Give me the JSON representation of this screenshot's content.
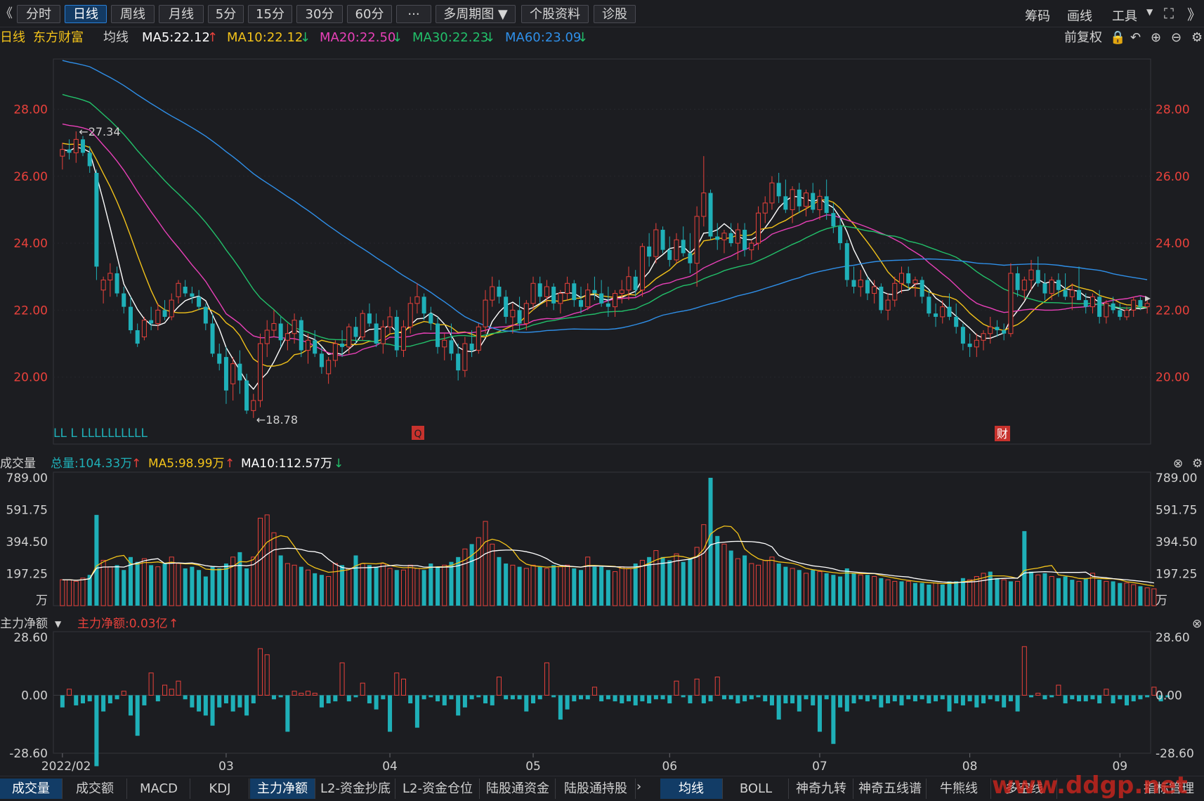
{
  "toolbar": {
    "collapse": "《",
    "tabs": [
      "分时",
      "日线",
      "周线",
      "月线",
      "5分",
      "15分",
      "30分",
      "60分",
      "···",
      "多周期图",
      "个股资料",
      "诊股"
    ],
    "active_tab": "日线",
    "right": [
      "筹码",
      "画线",
      "工具"
    ]
  },
  "infobar": {
    "period": "日线",
    "stock": "东方财富",
    "indicator": "均线",
    "ma5": "MA5:22.12",
    "ma10": "MA10:22.12",
    "ma20": "MA20:22.50",
    "ma30": "MA30:22.23",
    "ma60": "MA60:23.09",
    "adjust": "前复权"
  },
  "colors": {
    "up": "#e8413b",
    "down": "#1fb0b8",
    "ma5": "#ffffff",
    "ma10": "#f2c21a",
    "ma20": "#e840b8",
    "ma30": "#22c06a",
    "ma60": "#2f8fe8"
  },
  "price_panel": {
    "y_ticks": [
      "28.00",
      "26.00",
      "24.00",
      "22.00",
      "20.00"
    ],
    "high_label": "←27.34",
    "low_label": "←18.78",
    "event_markers": [
      "LL L LLLLLLLLLL",
      "Q",
      "财"
    ]
  },
  "volume_panel": {
    "title": "成交量",
    "total": "总量:104.33万",
    "ma5": "MA5:98.99万",
    "ma10": "MA10:112.57万",
    "y_ticks": [
      "789.00",
      "591.75",
      "394.50",
      "197.25"
    ],
    "unit": "万"
  },
  "flow_panel": {
    "title": "主力净额",
    "value": "主力净额:0.03亿",
    "y_ticks": [
      "28.60",
      "0.00",
      "-28.60"
    ]
  },
  "x_axis": [
    "2022/02",
    "03",
    "04",
    "05",
    "06",
    "07",
    "08",
    "09"
  ],
  "bottom_tabs_left": [
    "成交量",
    "成交额",
    "MACD",
    "KDJ",
    "主力净额",
    "L2-资金抄底",
    "L2-资金仓位",
    "陆股通资金",
    "陆股通持股"
  ],
  "bottom_tabs_right": [
    "均线",
    "BOLL",
    "神奇九转",
    "神奇五线谱",
    "牛熊线",
    "多空线",
    "指标管理"
  ],
  "watermark": "www.ddgp.net",
  "chart_data": {
    "type": "candlestick",
    "title": "东方财富 日线",
    "x_range": [
      "2022/02",
      "2022/09"
    ],
    "ylim": [
      18.0,
      29.5
    ],
    "annotations": {
      "high": 27.34,
      "low": 18.78
    },
    "ohlc": [
      [
        26.6,
        27.0,
        26.2,
        26.8
      ],
      [
        26.8,
        27.1,
        26.5,
        26.7
      ],
      [
        26.7,
        27.34,
        26.4,
        27.1
      ],
      [
        27.1,
        27.2,
        26.6,
        26.7
      ],
      [
        26.7,
        26.9,
        26.1,
        26.3
      ],
      [
        26.1,
        26.2,
        22.9,
        23.3
      ],
      [
        22.6,
        23.0,
        22.2,
        22.9
      ],
      [
        22.9,
        23.4,
        22.4,
        23.1
      ],
      [
        23.1,
        23.3,
        22.4,
        22.5
      ],
      [
        22.5,
        22.7,
        21.9,
        22.1
      ],
      [
        22.1,
        22.4,
        21.3,
        21.4
      ],
      [
        21.4,
        21.6,
        20.9,
        21.0
      ],
      [
        21.2,
        21.8,
        21.1,
        21.7
      ],
      [
        21.7,
        22.1,
        21.4,
        21.6
      ],
      [
        21.6,
        22.2,
        21.4,
        22.0
      ],
      [
        22.0,
        22.3,
        21.7,
        21.8
      ],
      [
        21.8,
        22.5,
        21.7,
        22.3
      ],
      [
        22.4,
        22.9,
        22.2,
        22.8
      ],
      [
        22.7,
        22.9,
        22.4,
        22.5
      ],
      [
        22.5,
        22.7,
        22.2,
        22.4
      ],
      [
        22.4,
        22.6,
        22.0,
        22.1
      ],
      [
        22.1,
        22.2,
        21.4,
        21.6
      ],
      [
        21.6,
        21.9,
        20.6,
        20.7
      ],
      [
        20.7,
        21.0,
        20.2,
        20.4
      ],
      [
        20.6,
        20.9,
        19.2,
        19.6
      ],
      [
        19.8,
        20.6,
        19.3,
        20.4
      ],
      [
        20.4,
        20.8,
        19.5,
        19.9
      ],
      [
        19.9,
        20.1,
        18.9,
        19.0
      ],
      [
        19.0,
        19.5,
        18.78,
        19.3
      ],
      [
        19.3,
        21.3,
        19.1,
        21.0
      ],
      [
        21.0,
        21.7,
        20.6,
        21.4
      ],
      [
        21.4,
        22.0,
        21.2,
        21.6
      ],
      [
        21.6,
        21.8,
        20.9,
        21.1
      ],
      [
        21.1,
        21.6,
        20.8,
        21.3
      ],
      [
        21.3,
        21.9,
        21.0,
        21.7
      ],
      [
        21.7,
        21.8,
        20.6,
        20.8
      ],
      [
        20.8,
        21.3,
        20.4,
        21.1
      ],
      [
        21.1,
        21.4,
        20.6,
        20.7
      ],
      [
        20.7,
        20.9,
        20.1,
        20.3
      ],
      [
        20.1,
        20.6,
        19.8,
        20.5
      ],
      [
        20.5,
        21.1,
        20.3,
        21.0
      ],
      [
        21.0,
        21.4,
        20.6,
        20.9
      ],
      [
        20.9,
        21.6,
        20.7,
        21.5
      ],
      [
        21.5,
        21.8,
        21.0,
        21.2
      ],
      [
        21.2,
        22.0,
        21.1,
        21.9
      ],
      [
        21.9,
        22.2,
        21.5,
        21.6
      ],
      [
        21.6,
        21.9,
        20.9,
        21.0
      ],
      [
        21.0,
        21.7,
        20.7,
        21.5
      ],
      [
        21.5,
        22.1,
        21.3,
        21.8
      ],
      [
        21.8,
        22.0,
        20.6,
        20.8
      ],
      [
        20.8,
        21.7,
        20.6,
        21.5
      ],
      [
        21.5,
        22.4,
        21.3,
        22.2
      ],
      [
        22.2,
        22.8,
        21.9,
        22.4
      ],
      [
        22.4,
        22.5,
        21.7,
        21.9
      ],
      [
        21.9,
        22.1,
        21.4,
        21.6
      ],
      [
        21.6,
        21.8,
        20.7,
        20.9
      ],
      [
        20.9,
        21.3,
        20.5,
        21.1
      ],
      [
        21.1,
        21.6,
        20.5,
        20.7
      ],
      [
        20.7,
        21.0,
        19.9,
        20.2
      ],
      [
        20.2,
        21.2,
        20.0,
        21.0
      ],
      [
        21.0,
        21.4,
        20.6,
        20.8
      ],
      [
        20.8,
        21.6,
        20.7,
        21.5
      ],
      [
        21.5,
        22.6,
        21.3,
        22.3
      ],
      [
        22.3,
        23.0,
        22.1,
        22.7
      ],
      [
        22.7,
        22.9,
        22.2,
        22.4
      ],
      [
        22.4,
        22.6,
        21.6,
        21.8
      ],
      [
        21.8,
        22.2,
        21.3,
        22.0
      ],
      [
        22.0,
        22.4,
        21.4,
        21.6
      ],
      [
        21.6,
        22.3,
        21.4,
        22.2
      ],
      [
        22.2,
        23.0,
        22.0,
        22.8
      ],
      [
        22.8,
        23.0,
        22.2,
        22.4
      ],
      [
        22.4,
        22.9,
        22.1,
        22.7
      ],
      [
        22.7,
        22.8,
        22.0,
        22.2
      ],
      [
        22.2,
        22.6,
        21.9,
        22.5
      ],
      [
        22.5,
        23.0,
        22.3,
        22.8
      ],
      [
        22.8,
        22.9,
        22.1,
        22.3
      ],
      [
        22.3,
        22.7,
        21.9,
        22.1
      ],
      [
        22.1,
        22.8,
        22.0,
        22.6
      ],
      [
        22.6,
        23.0,
        22.3,
        22.5
      ],
      [
        22.5,
        22.9,
        22.1,
        22.2
      ],
      [
        22.2,
        22.7,
        21.8,
        22.1
      ],
      [
        22.1,
        22.6,
        21.8,
        22.5
      ],
      [
        22.5,
        22.9,
        22.2,
        22.6
      ],
      [
        22.6,
        23.3,
        22.3,
        23.0
      ],
      [
        23.0,
        23.2,
        22.4,
        22.6
      ],
      [
        22.6,
        24.0,
        22.4,
        23.9
      ],
      [
        23.9,
        24.3,
        23.3,
        23.6
      ],
      [
        23.6,
        24.6,
        23.4,
        24.4
      ],
      [
        24.4,
        24.5,
        23.7,
        23.8
      ],
      [
        23.8,
        24.2,
        23.3,
        23.5
      ],
      [
        23.5,
        24.3,
        23.4,
        24.1
      ],
      [
        24.1,
        24.5,
        23.6,
        23.7
      ],
      [
        23.7,
        24.3,
        23.1,
        23.4
      ],
      [
        23.4,
        25.1,
        22.7,
        24.8
      ],
      [
        24.8,
        26.6,
        24.5,
        25.5
      ],
      [
        25.5,
        25.6,
        24.1,
        24.2
      ],
      [
        24.2,
        24.6,
        23.8,
        24.1
      ],
      [
        24.1,
        24.4,
        23.7,
        24.3
      ],
      [
        24.3,
        24.6,
        23.9,
        24.0
      ],
      [
        24.0,
        24.6,
        23.5,
        24.4
      ],
      [
        24.4,
        24.6,
        23.6,
        23.8
      ],
      [
        23.8,
        24.1,
        23.5,
        24.0
      ],
      [
        24.0,
        25.1,
        23.8,
        24.9
      ],
      [
        24.9,
        25.4,
        24.6,
        25.2
      ],
      [
        25.2,
        26.0,
        25.0,
        25.8
      ],
      [
        25.8,
        26.1,
        25.2,
        25.4
      ],
      [
        25.4,
        25.9,
        24.9,
        25.0
      ],
      [
        25.0,
        25.7,
        24.6,
        25.6
      ],
      [
        25.6,
        25.8,
        24.9,
        25.1
      ],
      [
        25.1,
        25.6,
        24.8,
        25.5
      ],
      [
        25.5,
        25.8,
        24.9,
        25.0
      ],
      [
        25.0,
        25.6,
        24.7,
        25.4
      ],
      [
        25.4,
        25.9,
        24.7,
        24.9
      ],
      [
        24.9,
        25.2,
        24.3,
        24.5
      ],
      [
        24.5,
        24.8,
        23.8,
        24.0
      ],
      [
        24.0,
        24.1,
        22.7,
        22.9
      ],
      [
        22.9,
        23.3,
        22.5,
        22.7
      ],
      [
        22.7,
        23.2,
        22.4,
        22.9
      ],
      [
        22.9,
        23.0,
        22.3,
        22.5
      ],
      [
        22.5,
        22.9,
        22.2,
        22.7
      ],
      [
        22.7,
        22.8,
        21.9,
        22.0
      ],
      [
        22.0,
        22.5,
        21.7,
        22.3
      ],
      [
        22.3,
        23.0,
        22.1,
        22.8
      ],
      [
        22.8,
        23.3,
        22.5,
        23.1
      ],
      [
        23.1,
        23.3,
        22.6,
        22.8
      ],
      [
        22.8,
        23.0,
        22.4,
        22.9
      ],
      [
        22.9,
        23.0,
        22.2,
        22.4
      ],
      [
        22.4,
        22.6,
        21.8,
        21.9
      ],
      [
        21.9,
        22.2,
        21.5,
        21.8
      ],
      [
        21.8,
        22.3,
        21.6,
        22.1
      ],
      [
        22.1,
        22.5,
        21.7,
        21.8
      ],
      [
        21.8,
        22.2,
        21.3,
        21.5
      ],
      [
        21.5,
        21.6,
        20.8,
        21.0
      ],
      [
        21.0,
        21.3,
        20.6,
        20.9
      ],
      [
        20.9,
        21.3,
        20.6,
        21.1
      ],
      [
        21.1,
        21.4,
        20.8,
        21.3
      ],
      [
        21.3,
        21.8,
        21.0,
        21.5
      ],
      [
        21.5,
        21.7,
        21.2,
        21.4
      ],
      [
        21.4,
        21.6,
        21.1,
        21.3
      ],
      [
        21.3,
        23.4,
        21.2,
        23.1
      ],
      [
        23.1,
        23.3,
        22.4,
        22.6
      ],
      [
        22.6,
        23.0,
        22.3,
        22.9
      ],
      [
        22.9,
        23.5,
        22.6,
        23.2
      ],
      [
        23.2,
        23.6,
        22.7,
        22.8
      ],
      [
        22.8,
        23.1,
        22.3,
        22.5
      ],
      [
        22.5,
        23.0,
        22.3,
        22.9
      ],
      [
        22.9,
        23.1,
        22.4,
        22.6
      ],
      [
        22.6,
        23.1,
        22.3,
        22.4
      ],
      [
        22.4,
        22.8,
        22.0,
        22.6
      ],
      [
        22.6,
        23.3,
        22.3,
        22.3
      ],
      [
        22.3,
        22.5,
        21.9,
        22.1
      ],
      [
        22.1,
        22.5,
        21.9,
        22.4
      ],
      [
        22.4,
        22.6,
        21.6,
        21.8
      ],
      [
        21.8,
        22.3,
        21.6,
        22.2
      ],
      [
        22.2,
        22.4,
        21.9,
        22.0
      ],
      [
        22.0,
        22.2,
        21.7,
        21.8
      ],
      [
        21.8,
        22.1,
        21.7,
        22.0
      ],
      [
        22.0,
        22.4,
        21.8,
        22.3
      ],
      [
        22.3,
        22.4,
        22.0,
        22.1
      ],
      [
        22.1,
        22.3,
        21.9,
        22.2
      ]
    ],
    "volume_ylim": [
      0,
      789.0
    ],
    "volume": [
      160,
      160,
      150,
      170,
      190,
      560,
      280,
      240,
      250,
      220,
      300,
      270,
      290,
      250,
      240,
      260,
      300,
      260,
      230,
      240,
      220,
      180,
      240,
      230,
      260,
      300,
      330,
      230,
      300,
      540,
      560,
      450,
      310,
      260,
      250,
      240,
      220,
      200,
      190,
      180,
      260,
      250,
      230,
      310,
      260,
      250,
      240,
      260,
      230,
      220,
      220,
      250,
      230,
      220,
      260,
      240,
      250,
      270,
      300,
      350,
      380,
      420,
      520,
      380,
      300,
      260,
      250,
      240,
      230,
      250,
      240,
      230,
      250,
      240,
      250,
      230,
      220,
      300,
      240,
      240,
      220,
      210,
      240,
      230,
      260,
      280,
      300,
      340,
      300,
      280,
      320,
      270,
      290,
      360,
      500,
      789,
      430,
      380,
      340,
      290,
      310,
      260,
      250,
      280,
      300,
      260,
      240,
      230,
      220,
      200,
      220,
      210,
      200,
      190,
      180,
      230,
      200,
      190,
      190,
      180,
      170,
      160,
      150,
      150,
      150,
      140,
      140,
      130,
      140,
      130,
      150,
      150,
      170,
      160,
      180,
      200,
      210,
      170,
      160,
      150,
      150,
      460,
      210,
      190,
      200,
      180,
      170,
      180,
      160,
      150,
      170,
      200,
      160,
      150,
      150,
      140,
      140,
      130,
      120,
      110,
      104
    ],
    "volume_up": [
      true,
      true,
      true,
      true,
      false,
      false,
      true,
      true,
      false,
      false,
      false,
      false,
      true,
      false,
      true,
      false,
      true,
      true,
      false,
      false,
      false,
      false,
      false,
      false,
      false,
      true,
      false,
      false,
      true,
      true,
      true,
      true,
      false,
      true,
      true,
      false,
      true,
      false,
      false,
      true,
      true,
      false,
      true,
      false,
      true,
      false,
      false,
      true,
      true,
      false,
      true,
      true,
      true,
      false,
      false,
      false,
      true,
      false,
      false,
      true,
      false,
      true,
      true,
      true,
      false,
      false,
      true,
      false,
      true,
      true,
      false,
      true,
      false,
      true,
      true,
      false,
      false,
      true,
      false,
      false,
      false,
      true,
      true,
      true,
      false,
      true,
      false,
      true,
      false,
      false,
      true,
      false,
      false,
      true,
      true,
      false,
      false,
      true,
      false,
      true,
      false,
      true,
      true,
      true,
      true,
      false,
      false,
      true,
      false,
      true,
      false,
      true,
      false,
      false,
      false,
      false,
      false,
      true,
      false,
      true,
      false,
      true,
      true,
      false,
      true,
      false,
      false,
      false,
      true,
      false,
      false,
      false,
      false,
      true,
      true,
      true,
      false,
      false,
      true,
      false,
      true,
      false,
      false,
      true,
      false,
      true,
      false,
      false,
      false,
      true,
      false,
      true,
      false,
      true,
      false,
      false,
      true,
      true,
      false,
      true,
      true
    ],
    "flow_ylim": [
      -28.6,
      28.6
    ],
    "flow": [
      -6,
      3,
      -5,
      -4,
      -3,
      -35,
      -8,
      -4,
      -2,
      2,
      -10,
      -20,
      -5,
      11,
      -3,
      5,
      3,
      7,
      -2,
      -6,
      -8,
      -10,
      -15,
      -6,
      -4,
      -8,
      -6,
      -10,
      -4,
      23,
      20,
      -2,
      -1,
      -18,
      2,
      1,
      2,
      1,
      -6,
      -4,
      -3,
      16,
      -3,
      -1,
      6,
      -4,
      -7,
      -2,
      -18,
      11,
      8,
      -4,
      -16,
      -2,
      -1,
      -3,
      -5,
      -2,
      -10,
      -6,
      -2,
      -1,
      -4,
      -5,
      9,
      -2,
      -2,
      -2,
      -8,
      -4,
      -2,
      16,
      -1,
      -12,
      -7,
      -3,
      -2,
      -2,
      4,
      -3,
      -2,
      -3,
      -4,
      -3,
      -5,
      -3,
      -4,
      -2,
      -2,
      -4,
      7,
      -1,
      -4,
      8,
      -4,
      -3,
      9,
      -2,
      -2,
      -4,
      -3,
      -2,
      -1,
      -3,
      -5,
      -12,
      -4,
      -4,
      -8,
      -2,
      -5,
      -18,
      -2,
      -24,
      -6,
      -8,
      -4,
      -2,
      -3,
      -2,
      -6,
      -4,
      -3,
      -5,
      -2,
      -3,
      -2,
      -4,
      -3,
      -2,
      -8,
      -4,
      -5,
      -3,
      -6,
      -4,
      -2,
      -3,
      -6,
      -3,
      -8,
      24,
      -1,
      1,
      -2,
      -1,
      5,
      -4,
      -2,
      -3,
      -3,
      -2,
      -4,
      3,
      -4,
      -2,
      -5,
      -3,
      -2,
      -1,
      4,
      -3,
      -1
    ],
    "ma_last": {
      "ma5": 22.12,
      "ma10": 22.12,
      "ma20": 22.5,
      "ma30": 22.23,
      "ma60": 23.09
    }
  }
}
